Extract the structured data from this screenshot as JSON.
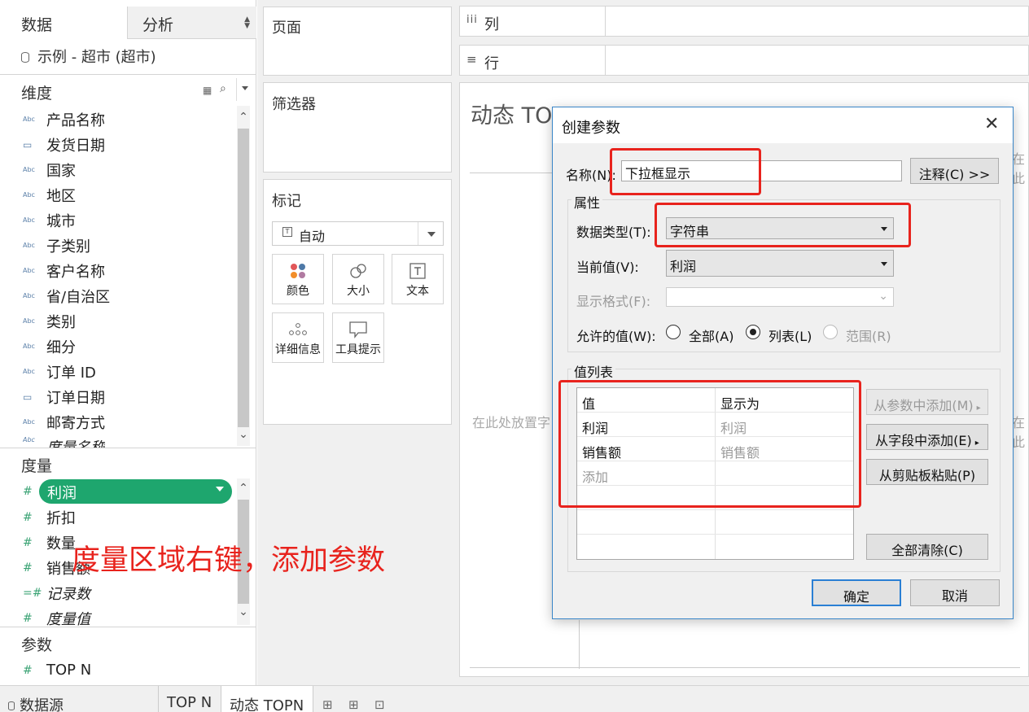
{
  "left_pane": {
    "tab_data": "数据",
    "tab_analysis": "分析",
    "datasource": "示例 - 超市 (超市)",
    "dimensions_title": "维度",
    "dimensions": [
      {
        "label": "产品名称",
        "type": "Abc"
      },
      {
        "label": "发货日期",
        "type": "date"
      },
      {
        "label": "国家",
        "type": "Abc"
      },
      {
        "label": "地区",
        "type": "Abc"
      },
      {
        "label": "城市",
        "type": "Abc"
      },
      {
        "label": "子类别",
        "type": "Abc"
      },
      {
        "label": "客户名称",
        "type": "Abc"
      },
      {
        "label": "省/自治区",
        "type": "Abc"
      },
      {
        "label": "类别",
        "type": "Abc"
      },
      {
        "label": "细分",
        "type": "Abc"
      },
      {
        "label": "订单 ID",
        "type": "Abc"
      },
      {
        "label": "订单日期",
        "type": "date"
      },
      {
        "label": "邮寄方式",
        "type": "Abc"
      },
      {
        "label": "度量名称",
        "type": "Abc"
      }
    ],
    "measures_title": "度量",
    "measures": [
      {
        "label": "利润"
      },
      {
        "label": "折扣"
      },
      {
        "label": "数量"
      },
      {
        "label": "销售额"
      },
      {
        "label": "记录数"
      },
      {
        "label": "度量值"
      }
    ],
    "parameters_title": "参数",
    "parameters": [
      {
        "label": "TOP N"
      }
    ]
  },
  "shelves": {
    "pages": "页面",
    "filters": "筛选器",
    "marks": "标记",
    "mark_type": "自动",
    "mark_buttons": [
      "颜色",
      "大小",
      "文本",
      "详细信息",
      "工具提示"
    ],
    "columns": "列",
    "rows": "行"
  },
  "view": {
    "title": "动态 TOPN",
    "drop_hint": "在此处放置字",
    "drop_hint_right": "在此"
  },
  "bottom_tabs": {
    "datasource": "数据源",
    "sheet1": "TOP N",
    "sheet2": "动态 TOPN"
  },
  "dialog": {
    "title": "创建参数",
    "name_label": "名称(N):",
    "name_value": "下拉框显示",
    "comment_button": "注释(C) >>",
    "properties_title": "属性",
    "data_type_label": "数据类型(T):",
    "data_type_value": "字符串",
    "current_value_label": "当前值(V):",
    "current_value": "利润",
    "display_format_label": "显示格式(F):",
    "display_format_value": "",
    "allowable_label": "允许的值(W):",
    "allow_all": "全部(A)",
    "allow_list": "列表(L)",
    "allow_range": "范围(R)",
    "allow_selected": "list",
    "value_list_title": "值列表",
    "columns": [
      "值",
      "显示为"
    ],
    "rows": [
      {
        "value": "利润",
        "display": "利润"
      },
      {
        "value": "销售额",
        "display": "销售额"
      },
      {
        "value": "添加",
        "display": ""
      }
    ],
    "add_from_param": "从参数中添加(M)",
    "add_from_field": "从字段中添加(E)",
    "paste_clipboard": "从剪贴板粘贴(P)",
    "clear_all": "全部清除(C)",
    "ok": "确定",
    "cancel": "取消"
  },
  "annotation": "度量区域右键，添加参数",
  "colors": {
    "accent_green": "#1ea66e",
    "highlight_red": "#e8231d",
    "dialog_border": "#3a86c8"
  }
}
